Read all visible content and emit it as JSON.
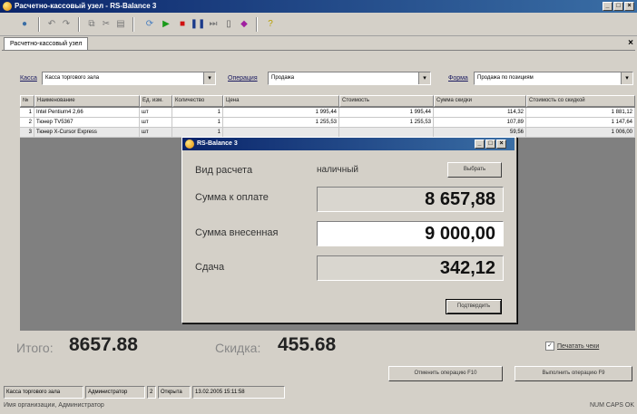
{
  "window": {
    "title": "Расчетно-кассовый узел - RS-Balance 3"
  },
  "tab": {
    "label": "Расчетно-кассовый узел"
  },
  "filters": {
    "cash_label": "Касса",
    "cash_value": "Касса торгового зала",
    "operation_label": "Операция",
    "operation_value": "Продажа",
    "form_label": "Форма",
    "form_value": "Продажа по позициям"
  },
  "grid": {
    "columns": [
      "№",
      "Наименование",
      "Ед. изм.",
      "Количество",
      "Цена",
      "Стоимость",
      "Сумма скидки",
      "Стоимость со скидкой"
    ],
    "rows": [
      {
        "n": "1",
        "name": "Intel Pentium4 2,66",
        "unit": "шт",
        "qty": "1",
        "price": "1 995,44",
        "cost": "1 995,44",
        "disc": "114,32",
        "total": "1 881,12"
      },
      {
        "n": "2",
        "name": "Тюнер TV5367",
        "unit": "шт",
        "qty": "1",
        "price": "1 255,53",
        "cost": "1 255,53",
        "disc": "107,89",
        "total": "1 147,64"
      },
      {
        "n": "3",
        "name": "Тюнер X-Cursor Express",
        "unit": "шт",
        "qty": "1",
        "price": "",
        "cost": "",
        "disc": "59,56",
        "total": "1 006,00"
      }
    ]
  },
  "totals": {
    "total_label": "Итого:",
    "total_value": "8657.88",
    "discount_label": "Скидка:",
    "discount_value": "455.68"
  },
  "options": {
    "print_check_label": "Печатать чеки"
  },
  "buttons": {
    "cancel_operation": "Отменить операцию F10",
    "execute_operation": "Выполнить операцию F9"
  },
  "status": {
    "cash": "Касса торгового зала",
    "user": "Администратор",
    "number": "2",
    "operation": "Открыта",
    "datetime": "13.02.2005 15:11:58"
  },
  "footer": {
    "text": "Имя организации, Администратор",
    "indicators": "NUM  CAPS  OK"
  },
  "dialog": {
    "title": "RS-Balance 3",
    "payment_type_label": "Вид расчета",
    "payment_type_value": "наличный",
    "choose_button": "Выбрать",
    "amount_due_label": "Сумма к оплате",
    "amount_due_value": "8 657,88",
    "amount_paid_label": "Сумма внесенная",
    "amount_paid_value": "9 000,00",
    "change_label": "Сдача",
    "change_value": "342,12",
    "confirm_button": "Подтвердить"
  }
}
